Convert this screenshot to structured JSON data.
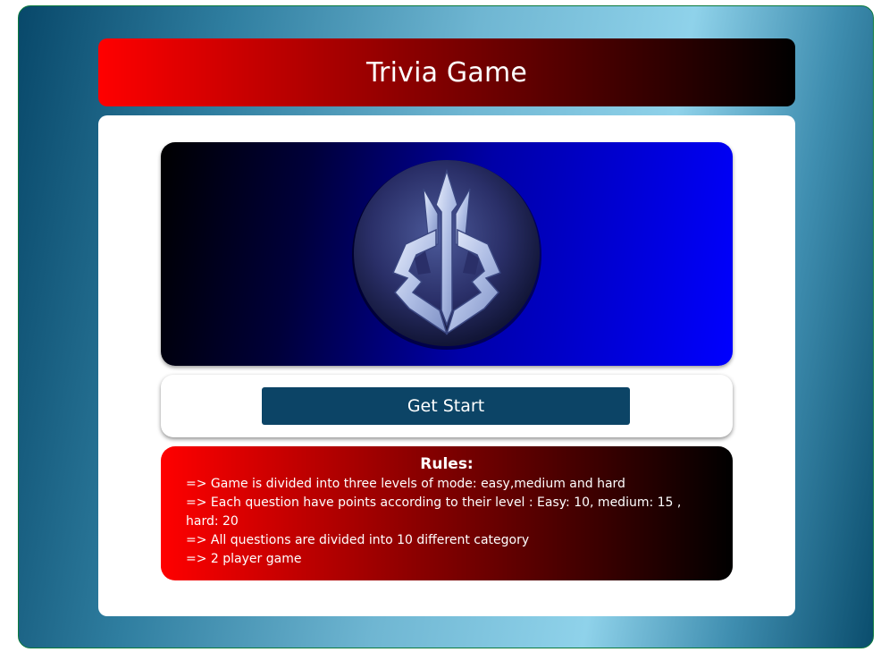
{
  "header": {
    "title": "Trivia Game"
  },
  "banner": {
    "logo_icon": "crest-logo-icon"
  },
  "start": {
    "button_label": "Get Start"
  },
  "rules": {
    "title": "Rules:",
    "items": [
      "=> Game is divided into three levels of mode: easy,medium and hard",
      "=> Each question have points according to their level : Easy: 10, medium: 15 , hard: 20",
      "=> All questions are divided into 10 different category",
      "=> 2 player game"
    ]
  },
  "colors": {
    "header_start": "#ff0000",
    "header_end": "#000000",
    "banner_start": "#000000",
    "banner_end": "#0000ff",
    "button": "#0c4466",
    "background_accent": "#8fd2ea"
  }
}
